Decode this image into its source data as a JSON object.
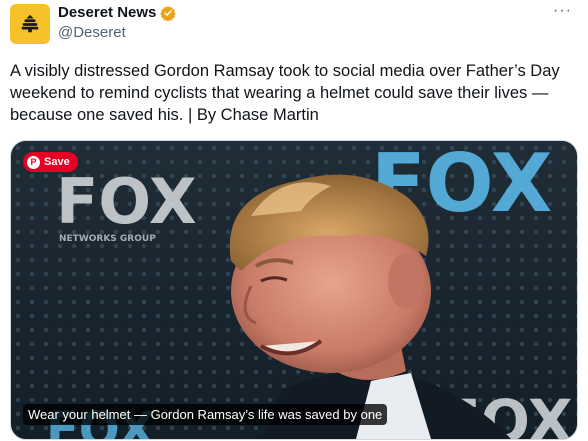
{
  "author": {
    "display_name": "Deseret News",
    "handle": "@Deseret",
    "verified": true,
    "avatar_icon": "beehive-icon",
    "avatar_color": "#f5c22b",
    "verified_color": "#e8a317"
  },
  "more_label": "···",
  "tweet_text": "A visibly distressed Gordon Ramsay took to social media over Father’s Day weekend to remind cyclists that wearing a helmet could save their lives — because one saved his. | By Chase Martin",
  "media": {
    "save_button_label": "Save",
    "save_button_color": "#e60023",
    "caption": "Wear your helmet — Gordon Ramsay’s life was saved by one",
    "backdrop_logo_left": "FOX",
    "backdrop_sub_left": "NETWORKS GROUP",
    "backdrop_logo_right": "FOX",
    "backdrop_logo_bottom_left": "FOX",
    "backdrop_logo_bottom_right": "FOX"
  }
}
